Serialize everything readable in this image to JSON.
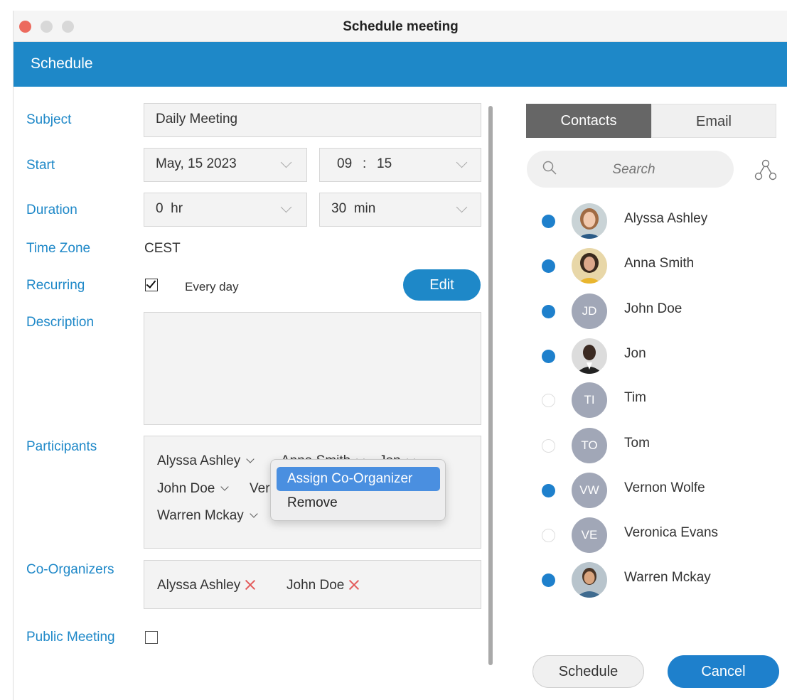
{
  "window": {
    "title": "Schedule meeting"
  },
  "header": {
    "title": "Schedule"
  },
  "form": {
    "subject_label": "Subject",
    "subject_value": "Daily Meeting",
    "start_label": "Start",
    "start_date": "May, 15 2023",
    "start_hour": "09",
    "start_sep": ":",
    "start_minute": "15",
    "duration_label": "Duration",
    "duration_hours": "0  hr",
    "duration_minutes": "30  min",
    "timezone_label": "Time Zone",
    "timezone_value": "CEST",
    "recurring_label": "Recurring",
    "recurring_checked": true,
    "recurring_text": "Every day",
    "edit_label": "Edit",
    "description_label": "Description",
    "description_value": "",
    "participants_label": "Participants",
    "participants": [
      "Alyssa Ashley",
      "Anna Smith",
      "Jon",
      "John Doe",
      "Ver",
      "Warren Mckay"
    ],
    "coorganizers_label": "Co-Organizers",
    "coorganizers": [
      "Alyssa Ashley",
      "John Doe"
    ],
    "public_label": "Public Meeting",
    "public_checked": false
  },
  "context_menu": {
    "items": [
      "Assign Co-Organizer",
      "Remove"
    ],
    "active_index": 0
  },
  "contacts_panel": {
    "tabs": [
      "Contacts",
      "Email"
    ],
    "active_tab": "Contacts",
    "search_placeholder": "Search",
    "contacts": [
      {
        "name": "Alyssa Ashley",
        "selected": true,
        "avatar": "photo"
      },
      {
        "name": "Anna Smith",
        "selected": true,
        "avatar": "photo"
      },
      {
        "name": "John Doe",
        "selected": true,
        "avatar": "JD"
      },
      {
        "name": "Jon",
        "selected": true,
        "avatar": "photo"
      },
      {
        "name": "Tim",
        "selected": false,
        "avatar": "TI"
      },
      {
        "name": "Tom",
        "selected": false,
        "avatar": "TO"
      },
      {
        "name": "Vernon Wolfe",
        "selected": true,
        "avatar": "VW"
      },
      {
        "name": "Veronica Evans",
        "selected": false,
        "avatar": "VE"
      },
      {
        "name": "Warren Mckay",
        "selected": true,
        "avatar": "photo"
      }
    ]
  },
  "actions": {
    "schedule_label": "Schedule",
    "cancel_label": "Cancel"
  },
  "colors": {
    "accent": "#1e88c8",
    "selected_dot": "#1e80cc",
    "remove_x": "#e35a5a",
    "menu_highlight": "#4a8fe0"
  }
}
